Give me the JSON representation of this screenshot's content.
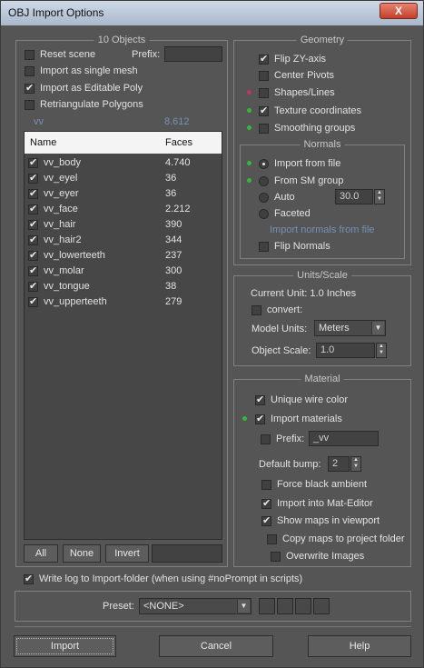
{
  "window": {
    "title": "OBJ Import Options",
    "close_label": "X"
  },
  "objects": {
    "group_title": "10 Objects",
    "reset_scene": {
      "label": "Reset scene",
      "checked": false
    },
    "prefix_label": "Prefix:",
    "prefix_value": "",
    "single_mesh": {
      "label": "Import as single mesh",
      "checked": false
    },
    "editable_poly": {
      "label": "Import as Editable Poly",
      "checked": true
    },
    "retriangulate": {
      "label": "Retriangulate Polygons",
      "checked": false
    },
    "disabled_vals": [
      "vv",
      "8.612"
    ],
    "columns": [
      "Name",
      "Faces"
    ],
    "items": [
      {
        "name": "vv_body",
        "faces": "4.740",
        "checked": true
      },
      {
        "name": "vv_eyel",
        "faces": "36",
        "checked": true
      },
      {
        "name": "vv_eyer",
        "faces": "36",
        "checked": true
      },
      {
        "name": "vv_face",
        "faces": "2.212",
        "checked": true
      },
      {
        "name": "vv_hair",
        "faces": "390",
        "checked": true
      },
      {
        "name": "vv_hair2",
        "faces": "344",
        "checked": true
      },
      {
        "name": "vv_lowerteeth",
        "faces": "237",
        "checked": true
      },
      {
        "name": "vv_molar",
        "faces": "300",
        "checked": true
      },
      {
        "name": "vv_tongue",
        "faces": "38",
        "checked": true
      },
      {
        "name": "vv_upperteeth",
        "faces": "279",
        "checked": true
      }
    ],
    "buttons": {
      "all": "All",
      "none": "None",
      "invert": "Invert"
    }
  },
  "geometry": {
    "group_title": "Geometry",
    "flip_zy": {
      "label": "Flip ZY-axis",
      "checked": true
    },
    "center_pivots": {
      "label": "Center Pivots",
      "checked": false
    },
    "shapes_lines": {
      "label": "Shapes/Lines",
      "checked": false
    },
    "texture_coords": {
      "label": "Texture coordinates",
      "checked": true
    },
    "smoothing_groups": {
      "label": "Smoothing groups",
      "checked": false
    }
  },
  "normals": {
    "group_title": "Normals",
    "from_file": "Import from file",
    "from_sm": "From SM group",
    "auto": "Auto",
    "auto_value": "30.0",
    "faceted": "Faceted",
    "disabled_note": "Import normals from file",
    "flip_normals": {
      "label": "Flip Normals",
      "checked": false
    }
  },
  "units": {
    "group_title": "Units/Scale",
    "current_unit": "Current Unit:  1.0 Inches",
    "convert": {
      "label": "convert:",
      "checked": false
    },
    "model_units_label": "Model Units:",
    "model_units_value": "Meters",
    "object_scale_label": "Object Scale:",
    "object_scale_value": "1.0"
  },
  "material": {
    "group_title": "Material",
    "unique_wire": {
      "label": "Unique wire color",
      "checked": true
    },
    "import_materials": {
      "label": "Import materials",
      "checked": true
    },
    "prefix": {
      "label": "Prefix:",
      "checked": false,
      "value": "_vv"
    },
    "default_bump_label": "Default bump:",
    "default_bump_value": "2",
    "force_black": {
      "label": "Force black ambient",
      "checked": false
    },
    "into_mat_editor": {
      "label": "Import into Mat-Editor",
      "checked": true
    },
    "show_maps": {
      "label": "Show maps in viewport",
      "checked": true
    },
    "copy_maps": {
      "label": "Copy maps to project folder",
      "checked": false
    },
    "overwrite": {
      "label": "Overwrite Images",
      "checked": false
    }
  },
  "footer": {
    "write_log": {
      "label": "Write log to Import-folder (when using #noPrompt in scripts)",
      "checked": true
    },
    "preset_label": "Preset:",
    "preset_value": "<NONE>",
    "import_label": "Import",
    "cancel_label": "Cancel",
    "help_label": "Help"
  }
}
